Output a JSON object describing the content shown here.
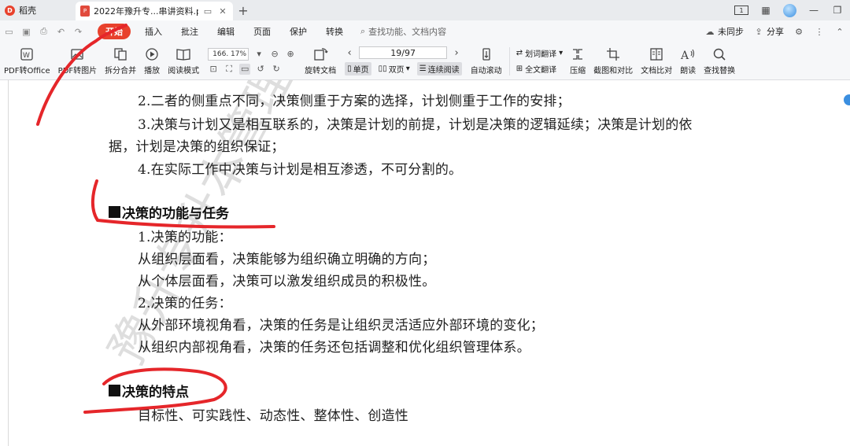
{
  "app_tab": {
    "label": "稻壳"
  },
  "doc_tab": {
    "title": "2022年豫升专...串讲资料.pdf"
  },
  "window": {
    "layout_label": "1"
  },
  "menu": {
    "items": [
      "开始",
      "插入",
      "批注",
      "编辑",
      "页面",
      "保护",
      "转换"
    ],
    "search_placeholder": "查找功能、文档内容",
    "sync": "未同步",
    "share": "分享"
  },
  "toolbar": {
    "pdf_to_office": "PDF转Office",
    "pdf_to_image": "PDF转图片",
    "split_merge": "拆分合并",
    "play": "播放",
    "read_mode": "阅读模式",
    "zoom": "166. 17%",
    "page": "19/97",
    "rotate": "旋转文档",
    "single": "单页",
    "double": "双页",
    "continuous": "连续阅读",
    "auto_scroll": "自动滚动",
    "word_translate": "划词翻译",
    "full_translate": "全文翻译",
    "compress": "压缩",
    "screenshot_compare": "截图和对比",
    "doc_compare": "文档比对",
    "read_aloud": "朗读",
    "find_replace": "查找替换"
  },
  "document": {
    "lines": [
      "2.二者的侧重点不同，决策侧重于方案的选择，计划侧重于工作的安排；",
      "3.决策与计划又是相互联系的，决策是计划的前提，计划是决策的逻辑延续；决策是计划的依",
      "据，计划是决策的组织保证；",
      "4.在实际工作中决策与计划是相互渗透，不可分割的。"
    ],
    "heading1": "决策的功能与任务",
    "section1": [
      "1.决策的功能：",
      "从组织层面看，决策能够为组织确立明确的方向；",
      "从个体层面看，决策可以激发组织成员的积极性。",
      "2.决策的任务：",
      "从外部环境视角看，决策的任务是让组织灵活适应外部环境的变化；",
      "从组织内部视角看，决策的任务还包括调整和优化组织管理体系。"
    ],
    "heading2": "决策的特点",
    "section2": [
      "目标性、可实践性、动态性、整体性、创造性"
    ]
  },
  "watermark": {
    "text": "豫升专升本管理学"
  },
  "colors": {
    "accent": "#e8412c",
    "ink": "#e5262a"
  }
}
